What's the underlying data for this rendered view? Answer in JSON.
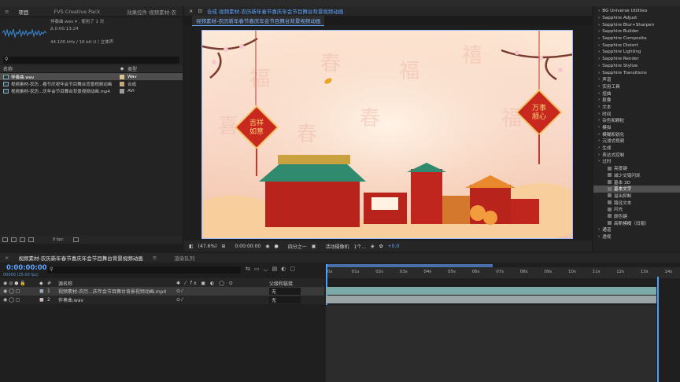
{
  "project": {
    "tabs": [
      "项目",
      "效果控件 视频素材-农"
    ],
    "preset_label": "FVS Creative Pack",
    "info": [
      "伴奏曲.wav ▾ , 使用了 1 次",
      "Δ 0:00:13:24",
      "44.100 kHz / 16 bit U / 立体声"
    ],
    "col_name": "名称",
    "col_type": "类型",
    "items": [
      {
        "name": "伴奏曲.wav",
        "type": "Wav",
        "color": "#d8c48c"
      },
      {
        "name": "视频素材-农历...春节庆祝年会节目舞台背景视频动画",
        "type": "合成",
        "color": "#c6a880"
      },
      {
        "name": "视频素材-农历...庆年会节目舞台背景视频动画.mp4",
        "type": "AVI",
        "color": "#9a9a9a"
      }
    ],
    "bpc": "8 bpc"
  },
  "comp": {
    "tab": "合成 视频素材-农历新年春节喜庆年会节目舞台背景视频动画",
    "crumb": "视频素材-农历新年春节喜庆年会节目舞台背景视频动画",
    "left_sign": "吉祥如意",
    "right_sign": "万事顺心",
    "zoom": "(47.6%)",
    "time": "0:00:00:00",
    "quality": "四分之一",
    "camera": "活动摄像机",
    "views": "1个...",
    "exposure": "+0.0"
  },
  "effects": [
    {
      "label": "BG Universe Utilities",
      "level": 0
    },
    {
      "label": "Sapphire Adjust",
      "level": 0
    },
    {
      "label": "Sapphire Blur+Sharpen",
      "level": 0
    },
    {
      "label": "Sapphire Builder",
      "level": 0
    },
    {
      "label": "Sapphire Composite",
      "level": 0
    },
    {
      "label": "Sapphire Distort",
      "level": 0
    },
    {
      "label": "Sapphire Lighting",
      "level": 0
    },
    {
      "label": "Sapphire Render",
      "level": 0
    },
    {
      "label": "Sapphire Stylize",
      "level": 0
    },
    {
      "label": "Sapphire Transitions",
      "level": 0
    },
    {
      "label": "声道",
      "level": 0
    },
    {
      "label": "实用工具",
      "level": 0
    },
    {
      "label": "扭曲",
      "level": 0
    },
    {
      "label": "抠像",
      "level": 0
    },
    {
      "label": "文本",
      "level": 0
    },
    {
      "label": "时间",
      "level": 0
    },
    {
      "label": "杂色和颗粒",
      "level": 0
    },
    {
      "label": "模拟",
      "level": 0
    },
    {
      "label": "模糊和锐化",
      "level": 0
    },
    {
      "label": "沉浸式视频",
      "level": 0
    },
    {
      "label": "生成",
      "level": 0
    },
    {
      "label": "表达式控制",
      "level": 0
    },
    {
      "label": "过时",
      "level": 0
    },
    {
      "label": "亮度键",
      "level": 1
    },
    {
      "label": "减少交错闪烁",
      "level": 1
    },
    {
      "label": "基本 3D",
      "level": 1
    },
    {
      "label": "基本文字",
      "level": 1,
      "sel": true
    },
    {
      "label": "溢出抑制",
      "level": 1
    },
    {
      "label": "路径文本",
      "level": 1
    },
    {
      "label": "闪光",
      "level": 1
    },
    {
      "label": "颜色键",
      "level": 1
    },
    {
      "label": "高斯模糊（旧版）",
      "level": 1
    },
    {
      "label": "通道",
      "level": 0
    },
    {
      "label": "透视",
      "level": 0
    }
  ],
  "timeline": {
    "tabs": [
      "视频素材-农历新年春节喜庆年会节目舞台背景视频动画",
      "渲染队列"
    ],
    "timecode": "0:00:00:00",
    "frames": "00000 (25.00 fps)",
    "col_src": "源名称",
    "col_parent": "父级和链接",
    "layers": [
      {
        "num": "1",
        "name": "视频素材-农历...庆年会节目舞台背景视频动画.mp4",
        "parent": "无"
      },
      {
        "num": "2",
        "name": "伴奏曲.wav",
        "parent": "无"
      }
    ],
    "ticks": [
      "0s",
      "01s",
      "02s",
      "03s",
      "04s",
      "05s",
      "06s",
      "07s",
      "08s",
      "09s",
      "10s",
      "11s",
      "12s",
      "13s",
      "14s"
    ]
  }
}
